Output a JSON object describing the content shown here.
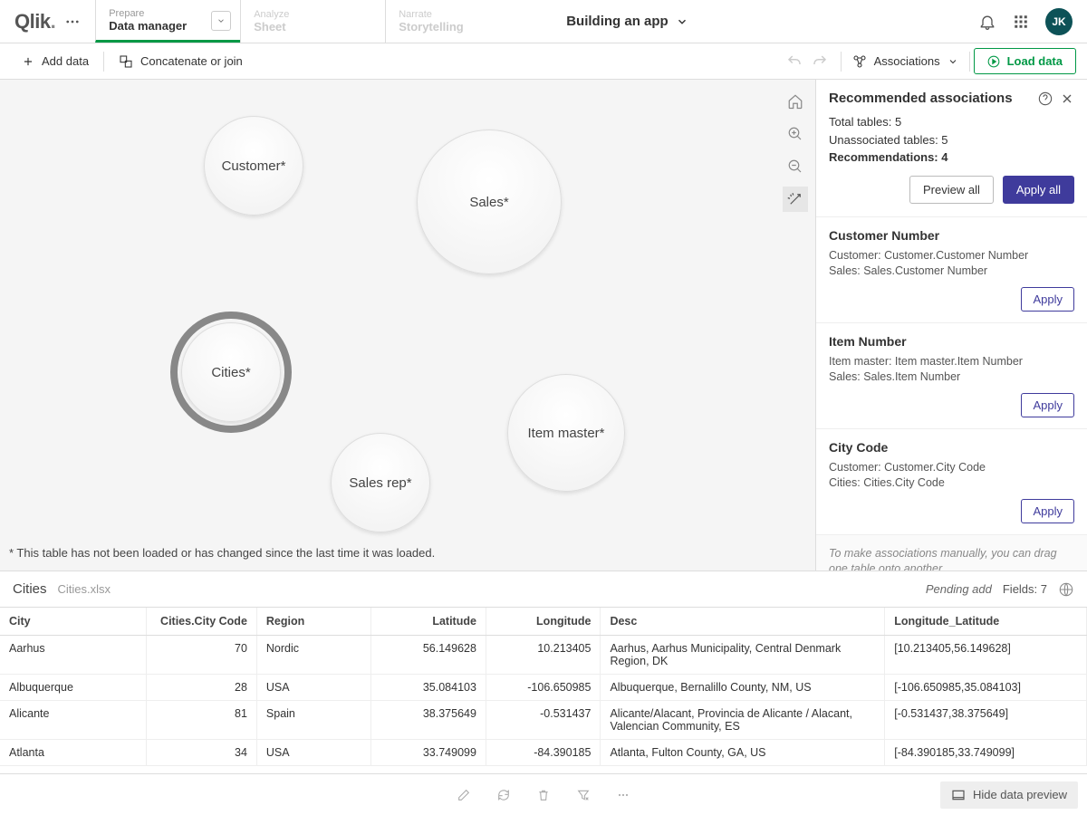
{
  "app": {
    "title": "Building an app"
  },
  "user": {
    "initials": "JK"
  },
  "nav": {
    "prepare": {
      "group": "Prepare",
      "label": "Data manager"
    },
    "analyze": {
      "group": "Analyze",
      "label": "Sheet"
    },
    "narrate": {
      "group": "Narrate",
      "label": "Storytelling"
    }
  },
  "toolbar": {
    "add_data": "Add data",
    "concatenate": "Concatenate or join",
    "associations": "Associations",
    "load_data": "Load data"
  },
  "bubbles": {
    "customer": "Customer*",
    "sales": "Sales*",
    "cities": "Cities*",
    "item_master": "Item master*",
    "sales_rep": "Sales rep*"
  },
  "canvas_note": "* This table has not been loaded or has changed since the last time it was loaded.",
  "panel": {
    "title": "Recommended associations",
    "total_label": "Total tables: ",
    "total_val": "5",
    "unassoc_label": "Unassociated tables: ",
    "unassoc_val": "5",
    "rec_label": "Recommendations: ",
    "rec_val": "4",
    "preview_all": "Preview all",
    "apply_all": "Apply all",
    "footer": "To make associations manually, you can drag one table onto another."
  },
  "recs": [
    {
      "title": "Customer Number",
      "l1": "Customer: Customer.Customer Number",
      "l2": "Sales: Sales.Customer Number",
      "apply": "Apply"
    },
    {
      "title": "Item Number",
      "l1": "Item master: Item master.Item Number",
      "l2": "Sales: Sales.Item Number",
      "apply": "Apply"
    },
    {
      "title": "City Code",
      "l1": "Customer: Customer.City Code",
      "l2": "Cities: Cities.City Code",
      "apply": "Apply"
    }
  ],
  "preview": {
    "table_name": "Cities",
    "file_name": "Cities.xlsx",
    "status": "Pending add",
    "fields_label": "Fields: 7",
    "headers": [
      "City",
      "Cities.City Code",
      "Region",
      "Latitude",
      "Longitude",
      "Desc",
      "Longitude_Latitude"
    ],
    "rows": [
      [
        "Aarhus",
        "70",
        "Nordic",
        "56.149628",
        "10.213405",
        "Aarhus, Aarhus Municipality, Central Denmark Region, DK",
        "[10.213405,56.149628]"
      ],
      [
        "Albuquerque",
        "28",
        "USA",
        "35.084103",
        "-106.650985",
        "Albuquerque, Bernalillo County, NM, US",
        "[-106.650985,35.084103]"
      ],
      [
        "Alicante",
        "81",
        "Spain",
        "38.375649",
        "-0.531437",
        "Alicante/Alacant, Provincia de Alicante / Alacant, Valencian Community, ES",
        "[-0.531437,38.375649]"
      ],
      [
        "Atlanta",
        "34",
        "USA",
        "33.749099",
        "-84.390185",
        "Atlanta, Fulton County, GA, US",
        "[-84.390185,33.749099]"
      ]
    ]
  },
  "bottom": {
    "hide": "Hide data preview"
  }
}
